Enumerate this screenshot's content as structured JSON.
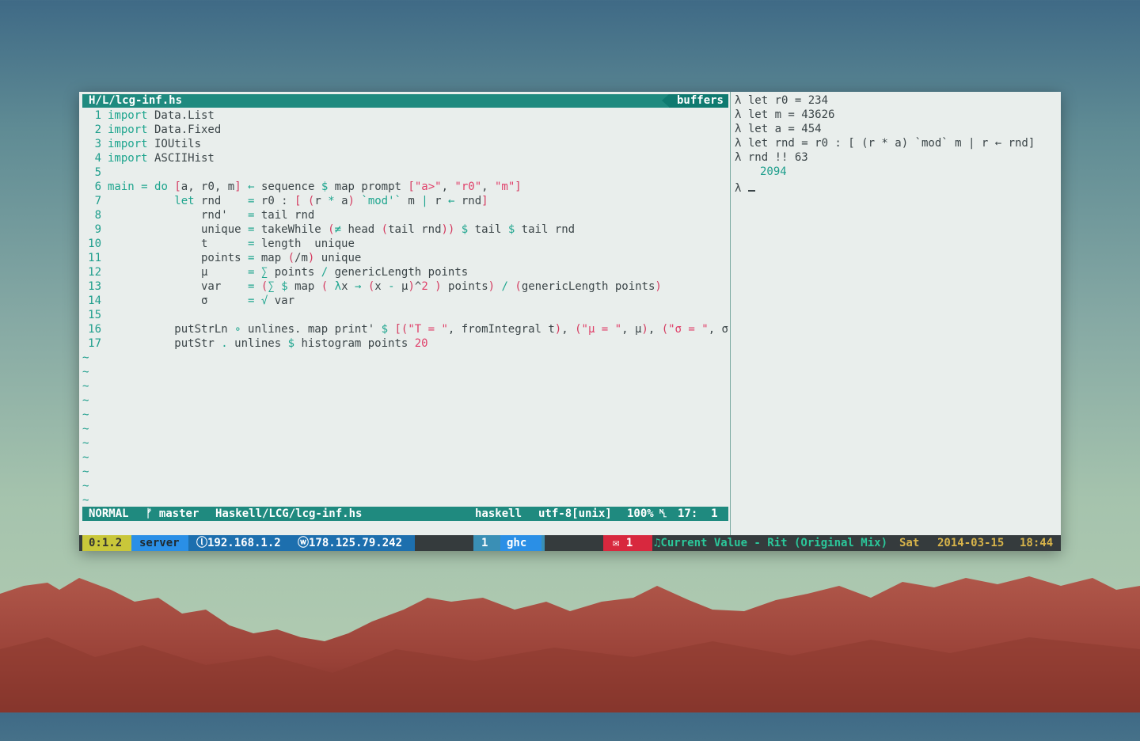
{
  "editor": {
    "tab_file": "H/L/lcg-inf.hs",
    "tab_buffers": "buffers",
    "code_lines": [
      {
        "n": "1",
        "text": "import Data.List"
      },
      {
        "n": "2",
        "text": "import Data.Fixed"
      },
      {
        "n": "3",
        "text": "import IOUtils"
      },
      {
        "n": "4",
        "text": "import ASCIIHist"
      },
      {
        "n": "5",
        "text": ""
      },
      {
        "n": "6",
        "text": "main = do [a, r0, m] ← sequence $ map prompt [\"a>\", \"r0\", \"m\"]"
      },
      {
        "n": "7",
        "text": "          let rnd    = r0 : [ (r * a) `mod'` m | r ← rnd]"
      },
      {
        "n": "8",
        "text": "              rnd'   = tail rnd"
      },
      {
        "n": "9",
        "text": "              unique = takeWhile (≠ head (tail rnd)) $ tail $ tail rnd"
      },
      {
        "n": "10",
        "text": "              t      = length  unique"
      },
      {
        "n": "11",
        "text": "              points = map (/m) unique"
      },
      {
        "n": "12",
        "text": "              μ      = ∑ points / genericLength points"
      },
      {
        "n": "13",
        "text": "              var    = (∑ $ map ( λx → (x - μ)^2 ) points) / (genericLength points)"
      },
      {
        "n": "14",
        "text": "              σ      = √ var"
      },
      {
        "n": "15",
        "text": ""
      },
      {
        "n": "16",
        "text": "          putStrLn ∘ unlines. map print' $ [(\"T = \", fromIntegral t), (\"μ = \", μ), (\"σ = \", σ)]"
      },
      {
        "n": "17",
        "text": "          putStr . unlines $ histogram points 20"
      }
    ],
    "tilde": "~",
    "status": {
      "mode": "NORMAL",
      "branch": "ᚠ master",
      "path": "Haskell/LCG/lcg-inf.hs",
      "filetype": "haskell",
      "encoding": "utf-8[unix]",
      "percent": "100%",
      "lnsym": "␤",
      "position": "17:  1"
    }
  },
  "repl": {
    "lines": [
      "λ let r0 = 234",
      "λ let m = 43626",
      "λ let a = 454",
      "λ let rnd = r0 : [ (r * a) `mod` m | r ← rnd]",
      "λ rnd !! 63"
    ],
    "output": "2094",
    "prompt": "λ "
  },
  "tmux": {
    "session": "0:1.2",
    "host": "server",
    "ip_local": "ⓛ192.168.1.2",
    "ip_wan": "ⓦ178.125.79.242",
    "window_index": "1",
    "window_name": "ghc",
    "mail": "✉ 1",
    "music": "♫Current Value - Rit (Original Mix)",
    "day": "Sat",
    "date": "2014-03-15",
    "time": "18:44"
  }
}
